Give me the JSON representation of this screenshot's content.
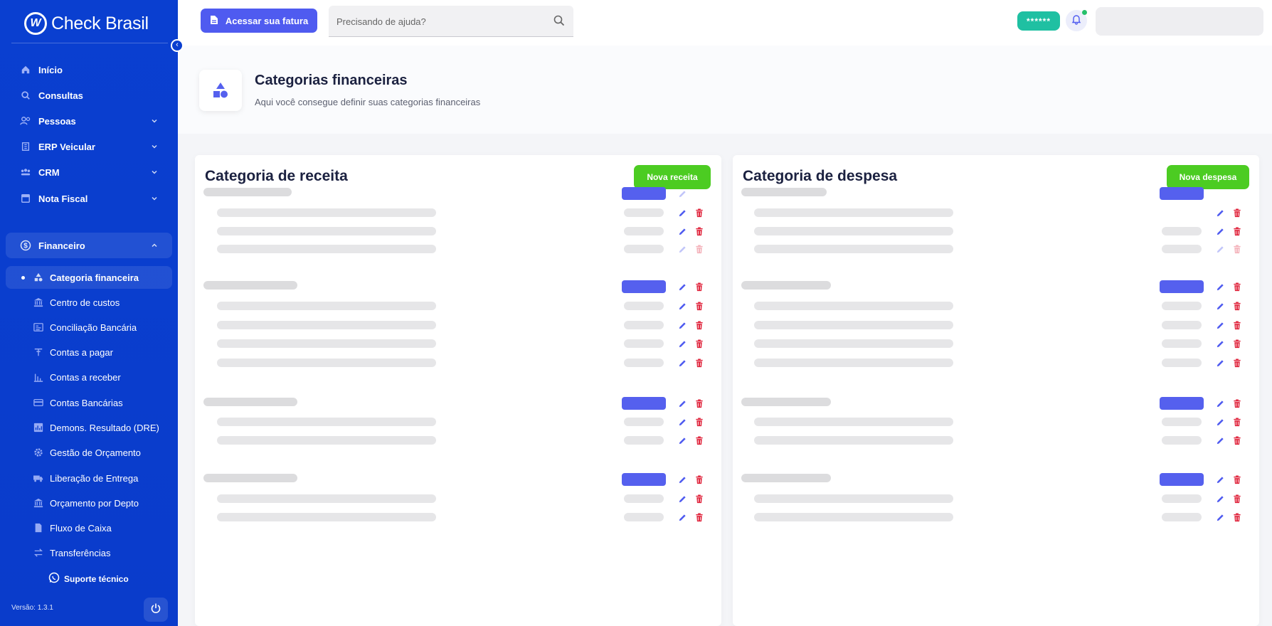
{
  "brand": {
    "logo": "W",
    "name": "Check Brasil"
  },
  "sidebar": {
    "items": [
      {
        "label": "Início",
        "icon": "home-icon"
      },
      {
        "label": "Consultas",
        "icon": "search-icon"
      },
      {
        "label": "Pessoas",
        "icon": "people-icon"
      },
      {
        "label": "ERP Veicular",
        "icon": "building-icon"
      },
      {
        "label": "CRM",
        "icon": "group-icon"
      },
      {
        "label": "Nota Fiscal",
        "icon": "receipt-icon"
      },
      {
        "label": "Financeiro",
        "icon": "dollar-icon"
      }
    ],
    "subitems": [
      {
        "label": "Categoria financeira",
        "icon": "shapes-icon"
      },
      {
        "label": "Centro de custos",
        "icon": "bank-icon"
      },
      {
        "label": "Conciliação Bancária",
        "icon": "ledger-icon"
      },
      {
        "label": "Contas a pagar",
        "icon": "pay-icon"
      },
      {
        "label": "Contas a receber",
        "icon": "bars-icon"
      },
      {
        "label": "Contas Bancárias",
        "icon": "card-icon"
      },
      {
        "label": "Demons. Resultado (DRE)",
        "icon": "chart-icon"
      },
      {
        "label": "Gestão de Orçamento",
        "icon": "gear-icon"
      },
      {
        "label": "Liberação de Entrega",
        "icon": "truck-icon"
      },
      {
        "label": "Orçamento por Depto",
        "icon": "bank-icon"
      },
      {
        "label": "Fluxo de Caixa",
        "icon": "document-icon"
      },
      {
        "label": "Transferências",
        "icon": "swap-icon"
      }
    ],
    "support": "Suporte técnico",
    "version": "Versão: 1.3.1"
  },
  "topbar": {
    "invoice_button": "Acessar sua fatura",
    "search_placeholder": "Precisando de ajuda?",
    "masked_pill": "******"
  },
  "page": {
    "title": "Categorias financeiras",
    "subtitle": "Aqui você consegue definir suas categorias financeiras"
  },
  "cards": [
    {
      "title": "Categoria de receita",
      "button": "Nova receita"
    },
    {
      "title": "Categoria de despesa",
      "button": "Nova despesa"
    }
  ],
  "colors": {
    "sidebar": "#0a3fd0",
    "primary": "#4f5bf0",
    "success": "#4ccc22",
    "teal": "#1fc0a2",
    "danger": "#e0243c"
  }
}
